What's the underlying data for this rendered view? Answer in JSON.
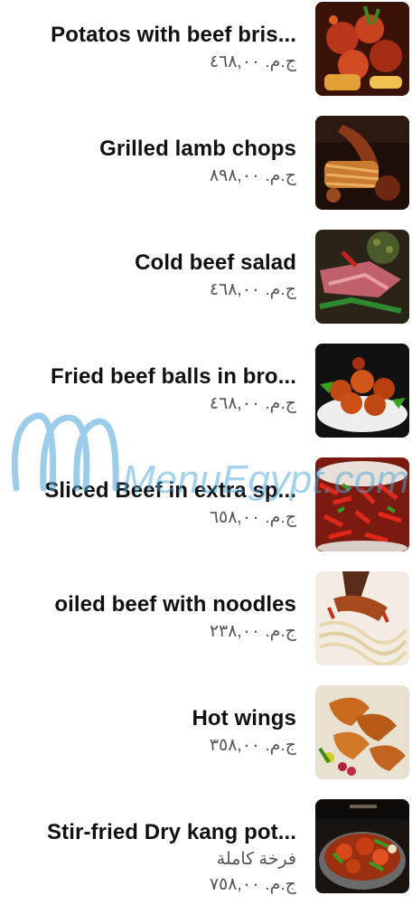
{
  "menu": {
    "items": [
      {
        "name": "Potatos with beef bris...",
        "sub": "",
        "price": "ج.م. ٤٦٨,٠٠",
        "image_icon": "beef-brisket-dish"
      },
      {
        "name": "Grilled lamb chops",
        "sub": "",
        "price": "ج.م. ٨٩٨,٠٠",
        "image_icon": "lamb-chops-dish"
      },
      {
        "name": "Cold beef salad",
        "sub": "",
        "price": "ج.م. ٤٦٨,٠٠",
        "image_icon": "beef-salad-dish"
      },
      {
        "name": "Fried beef balls in bro...",
        "sub": "",
        "price": "ج.م. ٤٦٨,٠٠",
        "image_icon": "beef-balls-dish"
      },
      {
        "name": "Sliced Beef in extra sp...",
        "sub": "",
        "price": "ج.م. ٦٥٨,٠٠",
        "image_icon": "spicy-beef-dish"
      },
      {
        "name": "oiled beef with noodles",
        "sub": "",
        "price": "ج.م. ٢٣٨,٠٠",
        "image_icon": "beef-noodles-dish"
      },
      {
        "name": "Hot wings",
        "sub": "",
        "price": "ج.م. ٣٥٨,٠٠",
        "image_icon": "hot-wings-dish"
      },
      {
        "name": "Stir-fried Dry kang pot...",
        "sub": "فرخة كاملة",
        "price": "ج.م. ٧٥٨,٠٠",
        "image_icon": "dry-pot-dish"
      }
    ]
  },
  "watermark": {
    "text": "MenuEgypt.com",
    "color": "#4aa3d8"
  },
  "colors": {
    "name_text": "#111111",
    "price_text": "#555555",
    "background": "#ffffff"
  }
}
